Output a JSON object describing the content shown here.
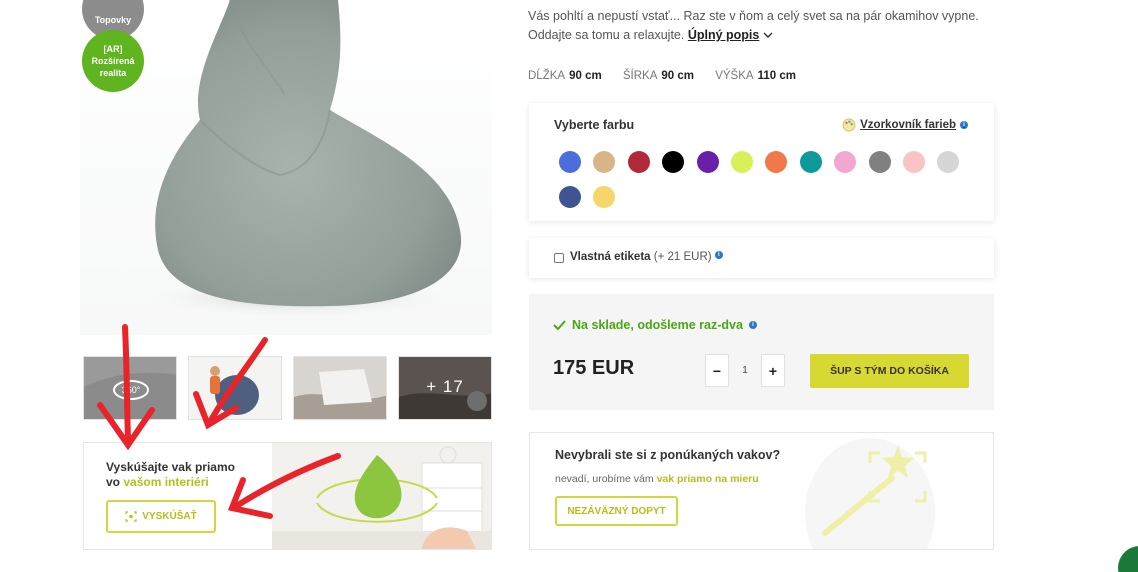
{
  "badges": {
    "top": "Topovky",
    "ar_line1": "[AR]",
    "ar_line2": "Rozšírená",
    "ar_line3": "realita"
  },
  "gallery": {
    "thumbs": [
      "360",
      "kid",
      "fabric",
      "more"
    ],
    "more_label": "+ 17"
  },
  "ar_banner": {
    "line1": "Vyskúšajte vak priamo",
    "line2_prefix": "vo ",
    "line2_highlight": "vašom interiéri",
    "button": "VYSKÚŠAŤ"
  },
  "description": {
    "line1": "Vás pohltí a nepustí vstať... Raz ste v ňom a celý svet sa na pár okamihov vypne.",
    "line2": "Oddajte sa tomu a relaxujte.",
    "more_link": "Úplný popis"
  },
  "dimensions": [
    {
      "label": "DĹŽKA",
      "value": "90 cm"
    },
    {
      "label": "ŠÍRKA",
      "value": "90 cm"
    },
    {
      "label": "VÝŠKA",
      "value": "110 cm"
    }
  ],
  "color_picker": {
    "title": "Vyberte farbu",
    "swatch_link": "Vzorkovník farieb",
    "colors": [
      "#4a6fdc",
      "#d8b487",
      "#b12a3a",
      "#000000",
      "#6a1fa8",
      "#d9f05a",
      "#f0784a",
      "#0f9a9a",
      "#f4a6d2",
      "#808080",
      "#f8c4c4",
      "#d6d6d6",
      "#3f5490",
      "#f6d66a"
    ]
  },
  "custom_label": {
    "text": "Vlastná etiketa",
    "price": "(+ 21 EUR)"
  },
  "buy": {
    "stock": "Na sklade, odošleme raz-dva",
    "price": "175 EUR",
    "minus": "−",
    "qty": "1",
    "plus": "+",
    "button": "ŠUP S TÝM DO KOŠÍKA"
  },
  "custom_order": {
    "title": "Nevybrali ste si z ponúkaných vakov?",
    "sub_prefix": "nevadí, urobíme vám ",
    "sub_highlight": "vak priamo na mieru",
    "button": "NEZÁVÄZNÝ DOPYT"
  },
  "colors": {
    "accent": "#d8d832",
    "stock_green": "#4aa614",
    "ar_badge": "#5fb41f",
    "annotation_red": "#e8232a"
  }
}
